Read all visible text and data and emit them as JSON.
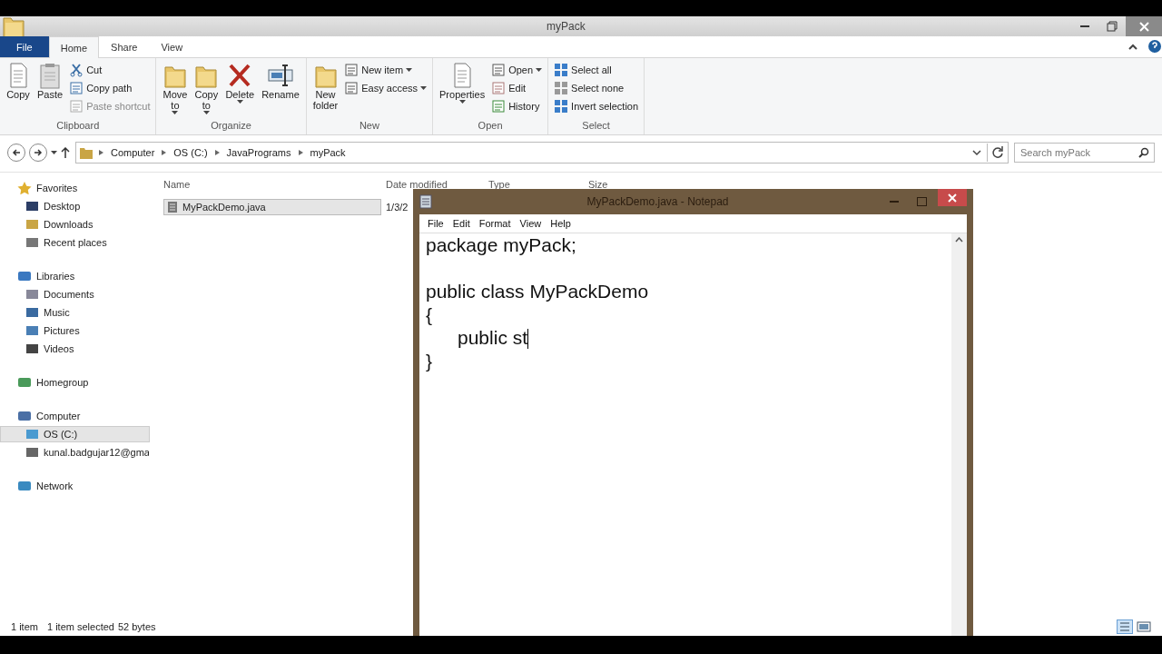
{
  "explorer": {
    "title": "myPack",
    "tabs": [
      {
        "label": "File",
        "kind": "file",
        "selected": false
      },
      {
        "label": "Home",
        "kind": "tab",
        "selected": true
      },
      {
        "label": "Share",
        "kind": "tab",
        "selected": false
      },
      {
        "label": "View",
        "kind": "tab",
        "selected": false
      }
    ],
    "ribbon_groups": [
      {
        "label": "Clipboard",
        "large": [
          {
            "lines": [
              "Copy"
            ],
            "dropdown": false
          },
          {
            "lines": [
              "Paste"
            ],
            "dropdown": false
          }
        ],
        "small": [
          {
            "label": "Cut",
            "dropdown": false,
            "disabled": false
          },
          {
            "label": "Copy path",
            "dropdown": false,
            "disabled": false
          },
          {
            "label": "Paste shortcut",
            "dropdown": false,
            "disabled": true
          }
        ]
      },
      {
        "label": "Organize",
        "large": [
          {
            "lines": [
              "Move",
              "to"
            ],
            "dropdown": true
          },
          {
            "lines": [
              "Copy",
              "to"
            ],
            "dropdown": true
          },
          {
            "lines": [
              "Delete"
            ],
            "dropdown": true
          },
          {
            "lines": [
              "Rename"
            ],
            "dropdown": false
          }
        ]
      },
      {
        "label": "New",
        "large": [
          {
            "lines": [
              "New",
              "folder"
            ],
            "dropdown": false
          }
        ],
        "small": [
          {
            "label": "New item",
            "dropdown": true,
            "disabled": false
          },
          {
            "label": "Easy access",
            "dropdown": true,
            "disabled": false
          }
        ]
      },
      {
        "label": "Open",
        "large": [
          {
            "lines": [
              "Properties"
            ],
            "dropdown": true
          }
        ],
        "small": [
          {
            "label": "Open",
            "dropdown": true,
            "disabled": false
          },
          {
            "label": "Edit",
            "dropdown": false,
            "disabled": false
          },
          {
            "label": "History",
            "dropdown": false,
            "disabled": false
          }
        ]
      },
      {
        "label": "Select",
        "small": [
          {
            "label": "Select all",
            "dropdown": false,
            "disabled": false
          },
          {
            "label": "Select none",
            "dropdown": false,
            "disabled": false
          },
          {
            "label": "Invert selection",
            "dropdown": false,
            "disabled": false
          }
        ]
      }
    ],
    "breadcrumb": [
      "Computer",
      "OS (C:)",
      "JavaPrograms",
      "myPack"
    ],
    "search": {
      "placeholder": "Search myPack"
    },
    "sidebar": [
      {
        "label": "Favorites",
        "selected": false,
        "children": [
          {
            "label": "Desktop",
            "selected": false
          },
          {
            "label": "Downloads",
            "selected": false
          },
          {
            "label": "Recent places",
            "selected": false
          }
        ]
      },
      {
        "label": "Libraries",
        "selected": false,
        "children": [
          {
            "label": "Documents",
            "selected": false
          },
          {
            "label": "Music",
            "selected": false
          },
          {
            "label": "Pictures",
            "selected": false
          },
          {
            "label": "Videos",
            "selected": false
          }
        ]
      },
      {
        "label": "Homegroup",
        "selected": false
      },
      {
        "label": "Computer",
        "selected": false,
        "children": [
          {
            "label": "OS (C:)",
            "selected": true
          },
          {
            "label": "kunal.badgujar12@gma",
            "selected": false
          }
        ]
      },
      {
        "label": "Network",
        "selected": false
      }
    ],
    "columns": [
      "Name",
      "Date modified",
      "Type",
      "Size"
    ],
    "rows": [
      {
        "name": "MyPackDemo.java",
        "date": "1/3/2",
        "selected": true
      }
    ],
    "status": {
      "count": "1 item",
      "selection": "1 item selected",
      "size": "52 bytes"
    }
  },
  "notepad": {
    "title": "MyPackDemo.java - Notepad",
    "menu": [
      "File",
      "Edit",
      "Format",
      "View",
      "Help"
    ],
    "text": "package myPack;\n\npublic class MyPackDemo\n{\n\tpublic st\n}"
  }
}
